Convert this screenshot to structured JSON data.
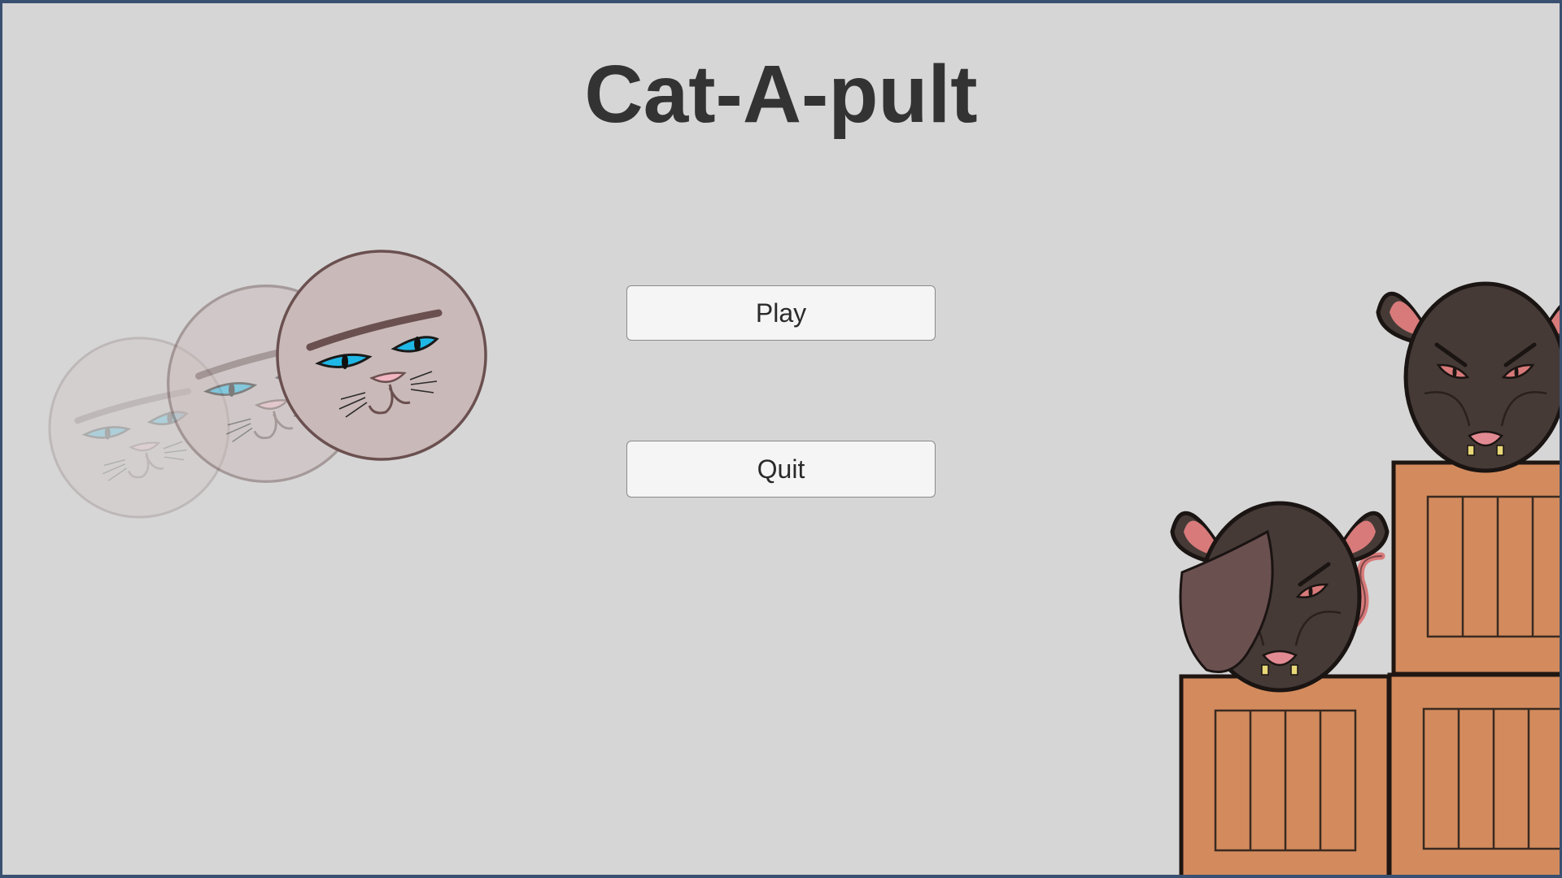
{
  "game": {
    "title": "Cat-A-pult"
  },
  "menu": {
    "play_label": "Play",
    "quit_label": "Quit"
  },
  "colors": {
    "background": "#d6d6d6",
    "frame": "#3a5071",
    "title_text": "#333333",
    "cat_fur": "#c9b9b8",
    "cat_outline": "#6b5050",
    "cat_eye": "#1fb8e6",
    "rat_fur": "#453a36",
    "rat_ear_inner": "#d87a7a",
    "crate": "#d38b5d",
    "crate_outline": "#1f1612"
  }
}
